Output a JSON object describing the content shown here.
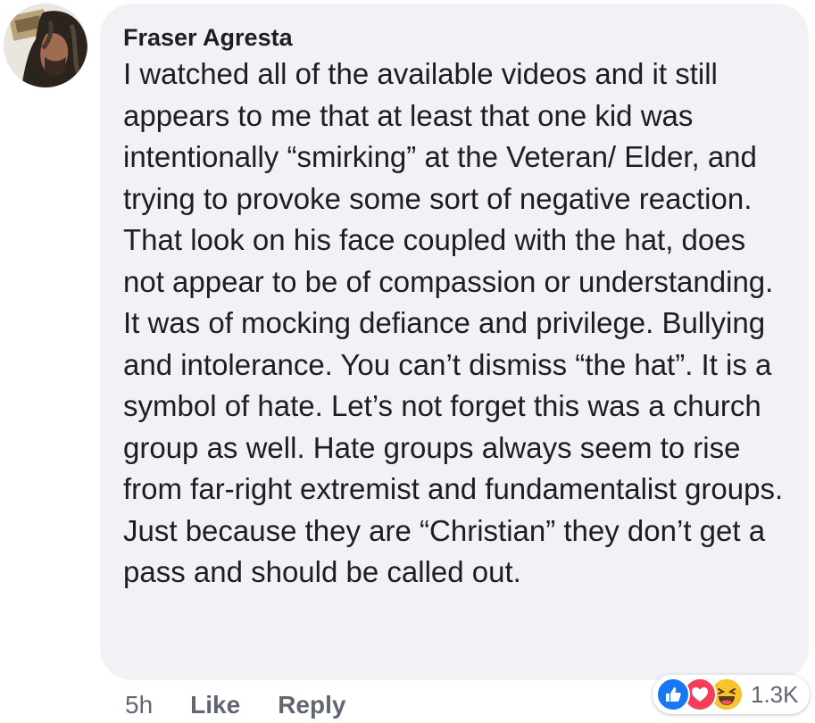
{
  "comment": {
    "author": "Fraser Agresta",
    "text": "I watched all of the available videos and it still appears to me that at least that one kid was intentionally “smirking” at the Veteran/ Elder, and trying to provoke some sort of negative reaction. That look on his face coupled with the hat, does not appear to be of compassion or understanding. It was of mocking defiance and privilege. Bullying and intolerance. You can’t dismiss “the hat”. It is a symbol of hate. Let’s not forget this was a church group as well. Hate groups always seem to rise from far-right extremist and fundamentalist groups. Just because they are “Christian” they don’t get a pass and should be called out.",
    "timestamp": "5h",
    "like_label": "Like",
    "reply_label": "Reply",
    "reactions": {
      "icons": [
        "like-icon",
        "love-icon",
        "haha-icon"
      ],
      "count": "1.3K"
    }
  },
  "colors": {
    "bubble_background": "#f0f2f5",
    "like_blue": "#1877f2",
    "love_red": "#f33e58",
    "haha_yellow": "#f7b125",
    "secondary_text": "#606770"
  }
}
